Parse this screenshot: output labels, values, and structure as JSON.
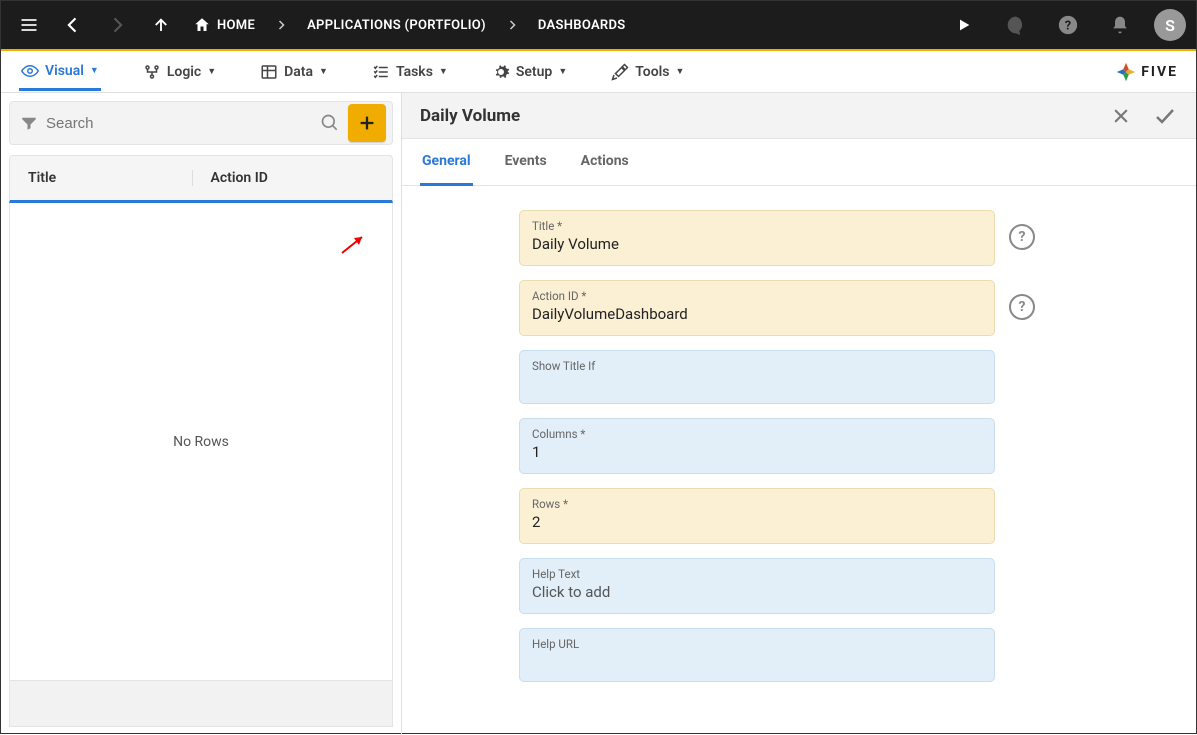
{
  "topbar": {
    "breadcrumb": [
      {
        "icon": "home",
        "label": "HOME"
      },
      {
        "label": "APPLICATIONS (PORTFOLIO)"
      },
      {
        "label": "DASHBOARDS"
      }
    ],
    "avatar": "S"
  },
  "menubar": {
    "items": [
      {
        "icon": "eye",
        "label": "Visual",
        "selected": true
      },
      {
        "icon": "logic",
        "label": "Logic"
      },
      {
        "icon": "data",
        "label": "Data"
      },
      {
        "icon": "tasks",
        "label": "Tasks"
      },
      {
        "icon": "gear",
        "label": "Setup"
      },
      {
        "icon": "tools",
        "label": "Tools"
      }
    ],
    "brand": "FIVE"
  },
  "left": {
    "search_placeholder": "Search",
    "columns": {
      "title": "Title",
      "action_id": "Action ID"
    },
    "empty_text": "No Rows"
  },
  "right": {
    "title": "Daily Volume",
    "tabs": [
      {
        "label": "General",
        "selected": true
      },
      {
        "label": "Events"
      },
      {
        "label": "Actions"
      }
    ],
    "fields": {
      "title": {
        "label": "Title *",
        "value": "Daily Volume"
      },
      "action_id": {
        "label": "Action ID *",
        "value": "DailyVolumeDashboard"
      },
      "show_title_if": {
        "label": "Show Title If",
        "value": ""
      },
      "columns": {
        "label": "Columns *",
        "value": "1"
      },
      "rows": {
        "label": "Rows *",
        "value": "2"
      },
      "help_text": {
        "label": "Help Text",
        "value": "Click to add"
      },
      "help_url": {
        "label": "Help URL",
        "value": ""
      }
    }
  }
}
